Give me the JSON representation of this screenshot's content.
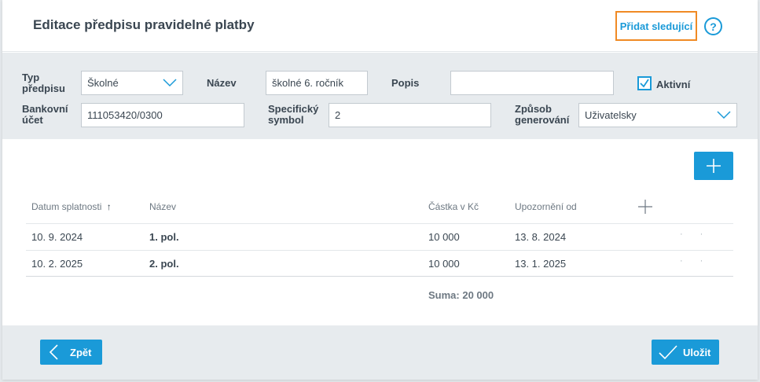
{
  "header": {
    "title": "Editace předpisu pravidelné platby",
    "add_next_label": "Přidat sledující",
    "help_label": "?"
  },
  "form": {
    "type": {
      "label_line1": "Typ",
      "label_line2": "předpisu",
      "value": "Školné"
    },
    "name": {
      "label": "Název",
      "value": "školné 6. ročník"
    },
    "description": {
      "label": "Popis",
      "value": ""
    },
    "active": {
      "label": "Aktivní",
      "checked": true
    },
    "bank_account": {
      "label_line1": "Bankovní",
      "label_line2": "účet",
      "value": "111053420/0300"
    },
    "specific_symbol": {
      "label_line1": "Specifický",
      "label_line2": "symbol",
      "value": "2"
    },
    "generation": {
      "label_line1": "Způsob",
      "label_line2": "generování",
      "value": "Uživatelsky"
    }
  },
  "table": {
    "columns": [
      "Datum splatnosti",
      "Název",
      "Částka v Kč",
      "Upozornění od"
    ],
    "sort_indicator": "↑",
    "rows": [
      {
        "due_date": "10. 9. 2024",
        "name": "1. pol.",
        "amount": "10 000",
        "notify_from": "13. 8. 2024"
      },
      {
        "due_date": "10. 2. 2025",
        "name": "2. pol.",
        "amount": "10 000",
        "notify_from": "13. 1. 2025"
      }
    ],
    "sum": "Suma: 20 000"
  },
  "footer": {
    "back_label": "Zpět",
    "save_label": "Uložit"
  },
  "icons": {
    "dropdown": "chevron-down-icon",
    "add": "plus-icon",
    "back": "chevron-left-icon",
    "save": "check-icon",
    "active": "checkbox-checked-icon"
  },
  "colors": {
    "accent": "#1a9ad8",
    "highlight": "#f08a24",
    "panel": "#e7ebee",
    "text": "#3a4651"
  }
}
